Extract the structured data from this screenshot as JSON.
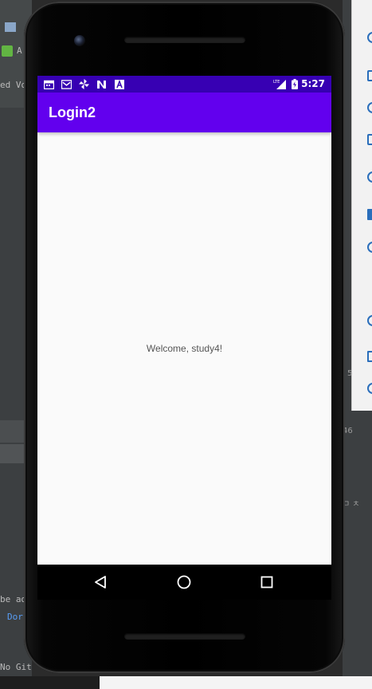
{
  "ide": {
    "left_rows": [
      {
        "text": "A"
      },
      {
        "text": "ed  Vo"
      },
      {
        "text": "be ad"
      },
      {
        "text": "Dor"
      },
      {
        "text": "No Gitflo"
      }
    ],
    "right_texts": [
      "46",
      "ㅁ ㅊ",
      "5"
    ]
  },
  "status_bar": {
    "time": "5:27",
    "network": "LTE",
    "icons": [
      "calendar-icon",
      "gmail-icon",
      "pinwheel-icon",
      "n-app-icon",
      "a-app-icon"
    ]
  },
  "app_bar": {
    "title": "Login2"
  },
  "content": {
    "welcome_text": "Welcome, study4!"
  },
  "nav": {
    "buttons": [
      "back-icon",
      "home-icon",
      "recents-icon"
    ]
  },
  "colors": {
    "status_bar": "#3700b3",
    "app_bar": "#6200ee",
    "background": "#fafafa"
  }
}
